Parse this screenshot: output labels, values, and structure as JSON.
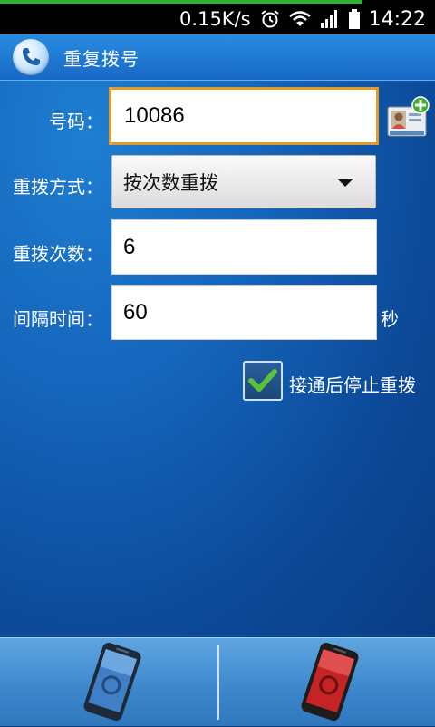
{
  "status_bar": {
    "net_speed": "0.15K/s",
    "time": "14:22",
    "icons": [
      "alarm-icon",
      "wifi-icon",
      "signal-icon",
      "battery-icon"
    ]
  },
  "title_bar": {
    "title": "重复拨号",
    "app_icon": "phone-handset-icon"
  },
  "form": {
    "number_label": "号码：",
    "number_value": "10086",
    "mode_label": "重拨方式：",
    "mode_selected": "按次数重拨",
    "count_label": "重拨次数：",
    "count_value": "6",
    "interval_label": "间隔时间：",
    "interval_value": "60",
    "interval_unit": "秒",
    "stop_on_connect_label": "接通后停止重拨",
    "stop_on_connect_checked": true
  },
  "bottom_bar": {
    "buttons": [
      {
        "name": "start-dial",
        "icon": "blue-phone-icon"
      },
      {
        "name": "stop-dial",
        "icon": "red-phone-icon"
      }
    ]
  },
  "colors": {
    "title_bar": "#1a74d0",
    "focus_border": "#e49a2a",
    "background": "#0c4a99",
    "checkmark": "#5cc23b"
  }
}
